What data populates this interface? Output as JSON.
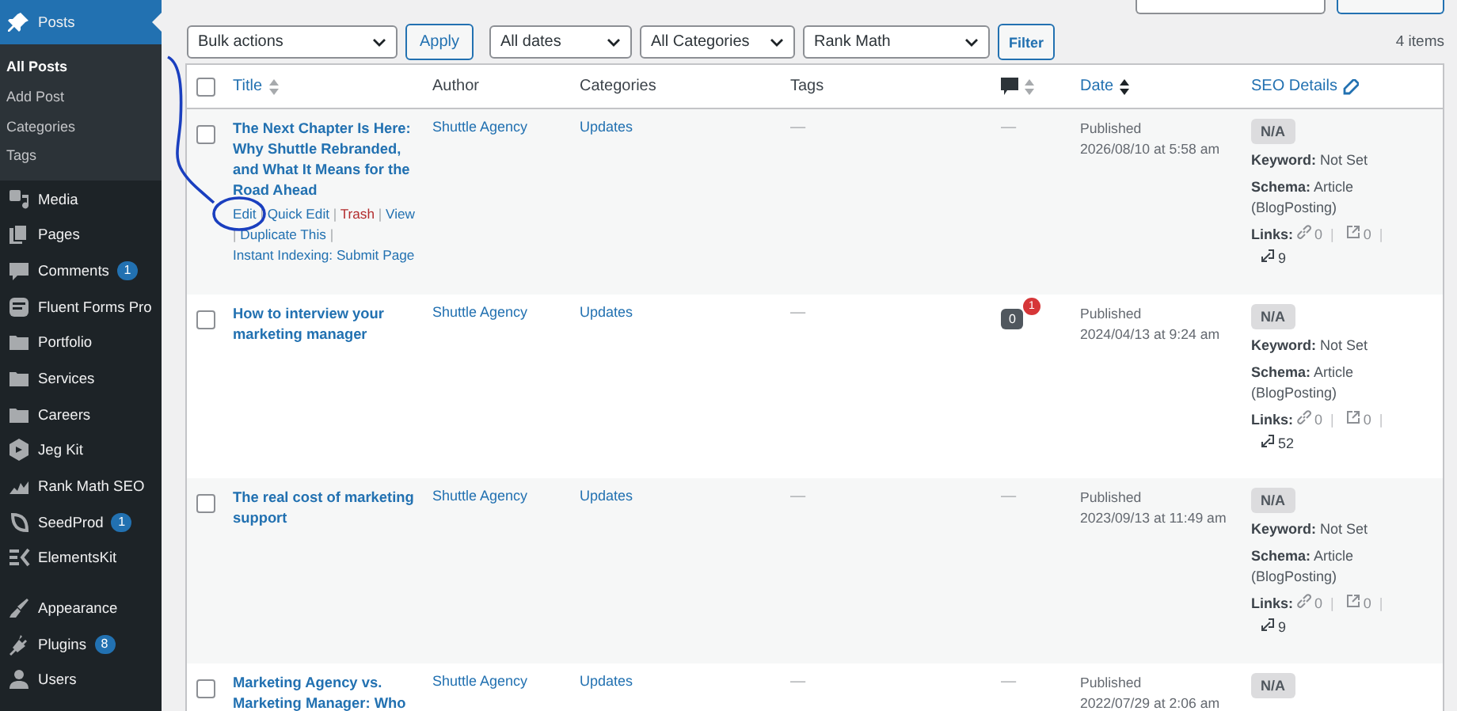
{
  "sidebar": {
    "items": [
      {
        "label": "Posts",
        "selected": true,
        "children": [
          {
            "label": "All Posts",
            "selected": true
          },
          {
            "label": "Add Post",
            "selected": false
          },
          {
            "label": "Categories",
            "selected": false
          },
          {
            "label": "Tags",
            "selected": false
          }
        ]
      },
      {
        "label": "Media",
        "selected": false
      },
      {
        "label": "Pages",
        "selected": false
      },
      {
        "label": "Comments",
        "selected": false,
        "badge": "1"
      },
      {
        "label": "Fluent Forms Pro",
        "selected": false
      },
      {
        "label": "Portfolio",
        "selected": false
      },
      {
        "label": "Services",
        "selected": false
      },
      {
        "label": "Careers",
        "selected": false
      },
      {
        "label": "Jeg Kit",
        "selected": false
      },
      {
        "label": "Rank Math SEO",
        "selected": false
      },
      {
        "label": "SeedProd",
        "selected": false,
        "badge": "1"
      },
      {
        "label": "ElementsKit",
        "selected": false
      },
      {
        "label": "Appearance",
        "selected": false,
        "separator_before": true
      },
      {
        "label": "Plugins",
        "selected": false,
        "badge": "8"
      },
      {
        "label": "Users",
        "selected": false
      }
    ]
  },
  "toolbar": {
    "bulk_actions": "Bulk actions",
    "apply": "Apply",
    "date_filter": "All dates",
    "category_filter": "All Categories",
    "seo_filter": "Rank Math",
    "filter": "Filter",
    "count": "4 items"
  },
  "table": {
    "select_all_checked": false,
    "columns": [
      {
        "label": "Title",
        "kind": "sortable",
        "sorted": false
      },
      {
        "label": "Author",
        "kind": "plain"
      },
      {
        "label": "Categories",
        "kind": "plain"
      },
      {
        "label": "Tags",
        "kind": "plain"
      },
      {
        "kind": "comments"
      },
      {
        "label": "Date",
        "kind": "sortable",
        "sorted": true
      },
      {
        "label": "SEO Details",
        "kind": "editable"
      }
    ],
    "rows": [
      {
        "checked": false,
        "title": "The Next Chapter Is Here: Why Shuttle Rebranded, and What It Means for the Road Ahead",
        "actions": [
          {
            "label": "Edit",
            "kind": "link"
          },
          {
            "label": "|",
            "kind": "separator"
          },
          {
            "label": "Quick Edit",
            "kind": "link"
          },
          {
            "label": "|",
            "kind": "separator"
          },
          {
            "label": "Trash",
            "kind": "danger"
          },
          {
            "label": "|",
            "kind": "separator"
          },
          {
            "label": "View",
            "kind": "link"
          },
          {
            "label": "|",
            "kind": "separator"
          },
          {
            "label": "Duplicate This",
            "kind": "link"
          },
          {
            "label": "|",
            "kind": "separator"
          },
          {
            "label": "Instant Indexing: Submit Page",
            "kind": "link"
          }
        ],
        "author": "Shuttle Agency",
        "category": "Updates",
        "tags": "—",
        "comments": {
          "kind": "none",
          "text": "—"
        },
        "status": "Published",
        "date": "2026/08/10 at 5:58 am",
        "seo": {
          "score": "N/A",
          "keyword_label": "Keyword:",
          "keyword": "Not Set",
          "schema_label": "Schema:",
          "schema": "Article (BlogPosting)",
          "links_label": "Links:",
          "internal": "0",
          "separator": "|",
          "external": "0",
          "incoming": "9"
        }
      },
      {
        "checked": false,
        "title": "How to interview your marketing manager",
        "author": "Shuttle Agency",
        "category": "Updates",
        "tags": "—",
        "comments": {
          "kind": "bubble",
          "count": "0",
          "pending": "1"
        },
        "status": "Published",
        "date": "2024/04/13 at 9:24 am",
        "seo": {
          "score": "N/A",
          "keyword_label": "Keyword:",
          "keyword": "Not Set",
          "schema_label": "Schema:",
          "schema": "Article (BlogPosting)",
          "links_label": "Links:",
          "internal": "0",
          "separator": "|",
          "external": "0",
          "incoming": "52"
        }
      },
      {
        "checked": false,
        "title": "The real cost of marketing support",
        "author": "Shuttle Agency",
        "category": "Updates",
        "tags": "—",
        "comments": {
          "kind": "none",
          "text": "—"
        },
        "status": "Published",
        "date": "2023/09/13 at 11:49 am",
        "seo": {
          "score": "N/A",
          "keyword_label": "Keyword:",
          "keyword": "Not Set",
          "schema_label": "Schema:",
          "schema": "Article (BlogPosting)",
          "links_label": "Links:",
          "internal": "0",
          "separator": "|",
          "external": "0",
          "incoming": "9"
        }
      },
      {
        "checked": false,
        "title": "Marketing Agency vs. Marketing Manager: Who",
        "author": "Shuttle Agency",
        "category": "Updates",
        "tags": "—",
        "comments": {
          "kind": "none",
          "text": "—"
        },
        "status": "Published",
        "date": "2022/07/29 at 2:06 am",
        "seo": {
          "score": "N/A"
        }
      }
    ]
  }
}
